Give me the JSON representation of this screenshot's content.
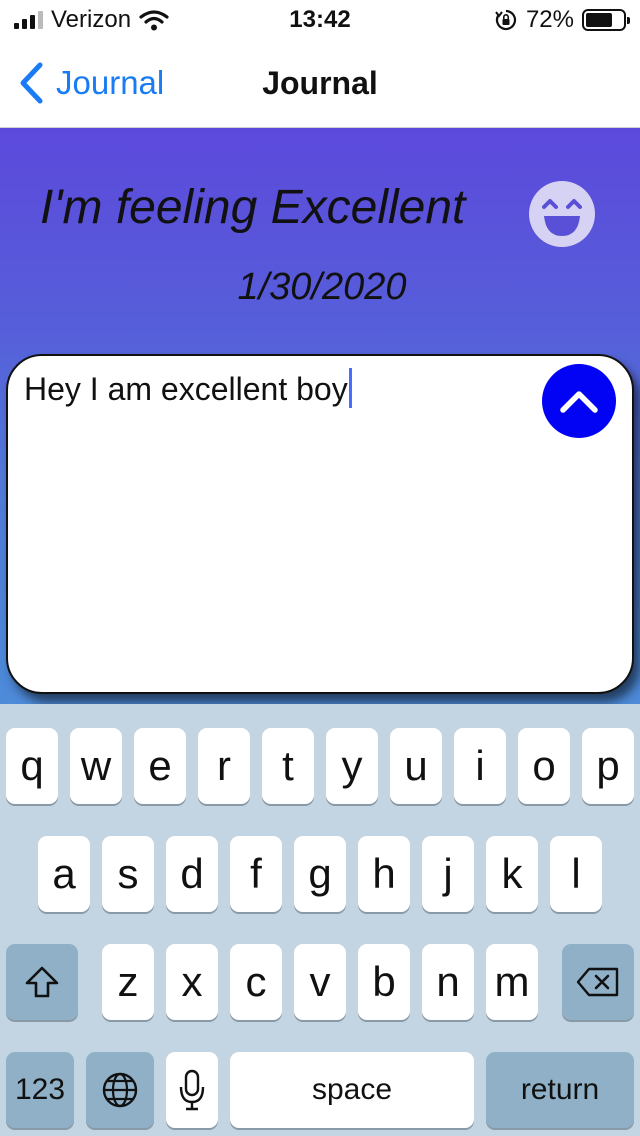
{
  "status_bar": {
    "carrier": "Verizon",
    "time": "13:42",
    "battery_percent": "72%",
    "battery_level": 0.72,
    "icons": [
      "signal-icon",
      "wifi-icon",
      "orientation-lock-icon",
      "battery-icon"
    ]
  },
  "nav": {
    "back_label": "Journal",
    "title": "Journal"
  },
  "entry": {
    "feeling_title": "I'm feeling Excellent",
    "mood_icon": "grinning-face-icon",
    "date": "1/30/2020",
    "note_text": "Hey I am excellent boy",
    "collapse_icon": "chevron-up-icon"
  },
  "colors": {
    "gradient_top": "#5c49dc",
    "gradient_bottom": "#4d8bd8",
    "accent_blue": "#1a7cf5",
    "button_blue": "#0202f5",
    "keyboard_bg": "#c3d5e2",
    "special_key": "#8fb0c7"
  },
  "keyboard": {
    "row1": [
      "q",
      "w",
      "e",
      "r",
      "t",
      "y",
      "u",
      "i",
      "o",
      "p"
    ],
    "row2": [
      "a",
      "s",
      "d",
      "f",
      "g",
      "h",
      "j",
      "k",
      "l"
    ],
    "row3": [
      "z",
      "x",
      "c",
      "v",
      "b",
      "n",
      "m"
    ],
    "numbers_label": "123",
    "space_label": "space",
    "return_label": "return"
  }
}
